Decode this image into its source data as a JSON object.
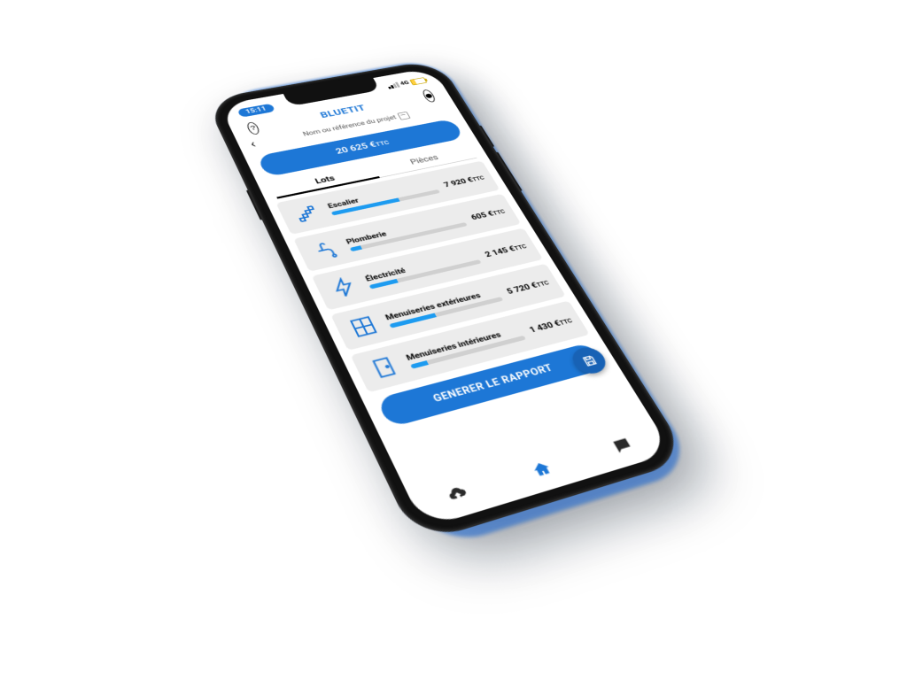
{
  "status": {
    "time": "15:11",
    "net_label": "4G"
  },
  "app": {
    "title": "BLUETIT"
  },
  "project": {
    "reference_placeholder": "Nom ou référence du projet"
  },
  "total": {
    "amount": "20 625 €",
    "suffix": "TTC"
  },
  "tabs": {
    "active": "Lots",
    "other": "Pièces"
  },
  "lots": [
    {
      "name": "Escalier",
      "amount": "7 920 €",
      "suffix": "TTC",
      "pct": 62
    },
    {
      "name": "Plomberie",
      "amount": "605 €",
      "suffix": "TTC",
      "pct": 9
    },
    {
      "name": "Électricité",
      "amount": "2 145 €",
      "suffix": "TTC",
      "pct": 24
    },
    {
      "name": "Menuiseries extérieures",
      "amount": "5 720 €",
      "suffix": "TTC",
      "pct": 40
    },
    {
      "name": "Menuiseries intérieures",
      "amount": "1 430 €",
      "suffix": "TTC",
      "pct": 14
    }
  ],
  "report_button": "GENERER LE RAPPORT",
  "colors": {
    "accent": "#1d77d6",
    "bar": "#1d9bf0"
  },
  "chart_data": {
    "type": "bar",
    "categories": [
      "Escalier",
      "Plomberie",
      "Électricité",
      "Menuiseries extérieures",
      "Menuiseries intérieures"
    ],
    "values": [
      7920,
      605,
      2145,
      5720,
      1430
    ],
    "title": "Lots",
    "xlabel": "",
    "ylabel": "€TTC",
    "ylim": [
      0,
      20625
    ]
  }
}
